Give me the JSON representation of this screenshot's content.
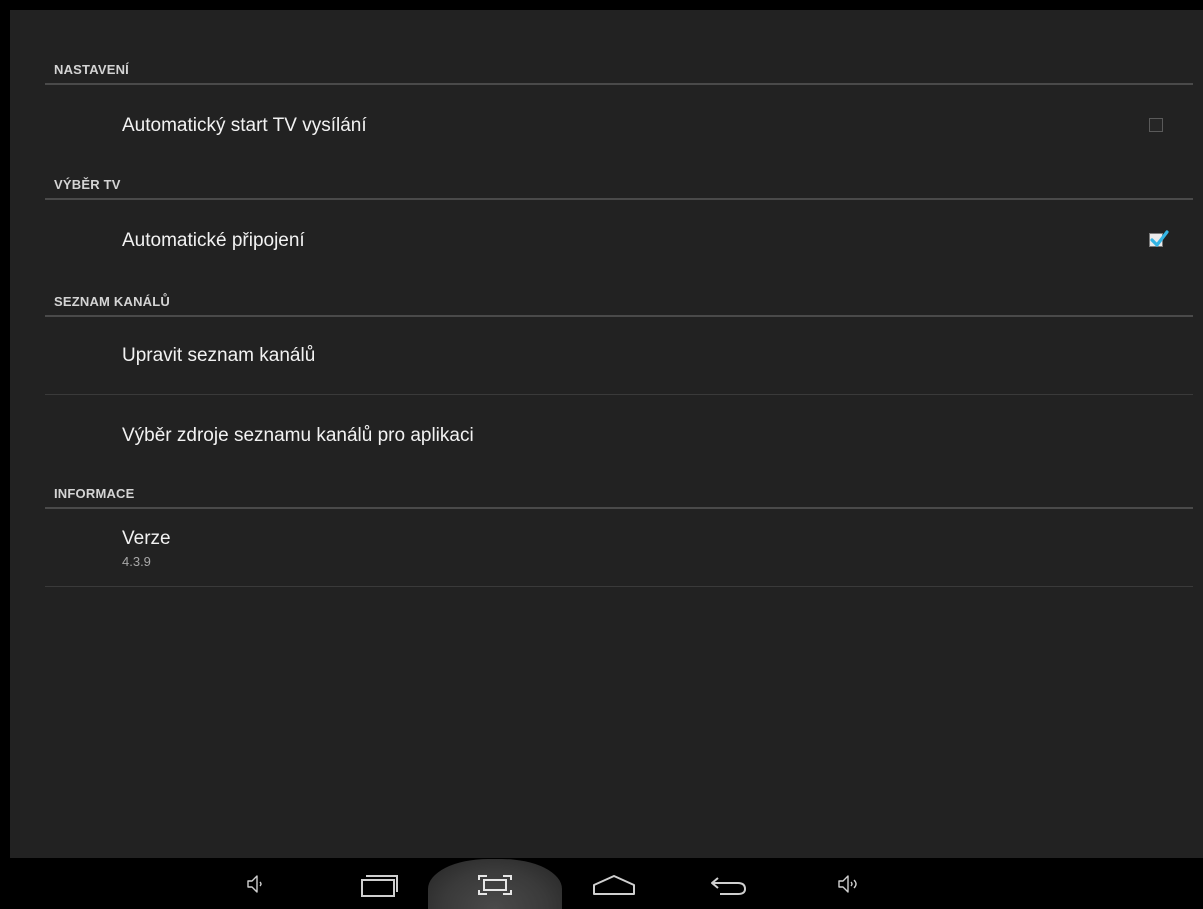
{
  "categories": {
    "settings": "NASTAVENÍ",
    "tv_select": "VÝBĚR TV",
    "channels": "SEZNAM KANÁLŮ",
    "info": "INFORMACE"
  },
  "prefs": {
    "autostart": {
      "title": "Automatický start TV vysílání",
      "checked": false
    },
    "autoconnect": {
      "title": "Automatické připojení",
      "checked": true
    },
    "edit_channels": {
      "title": "Upravit seznam kanálů"
    },
    "channel_source": {
      "title": "Výběr zdroje seznamu kanálů pro aplikaci"
    },
    "version": {
      "title": "Verze",
      "summary": "4.3.9"
    }
  },
  "navbar": {
    "icons": [
      "volume-down-icon",
      "recent-apps-icon",
      "screenshot-icon",
      "home-icon",
      "back-icon",
      "volume-up-icon"
    ]
  },
  "colors": {
    "accent": "#33b5e5",
    "background": "#222222"
  }
}
